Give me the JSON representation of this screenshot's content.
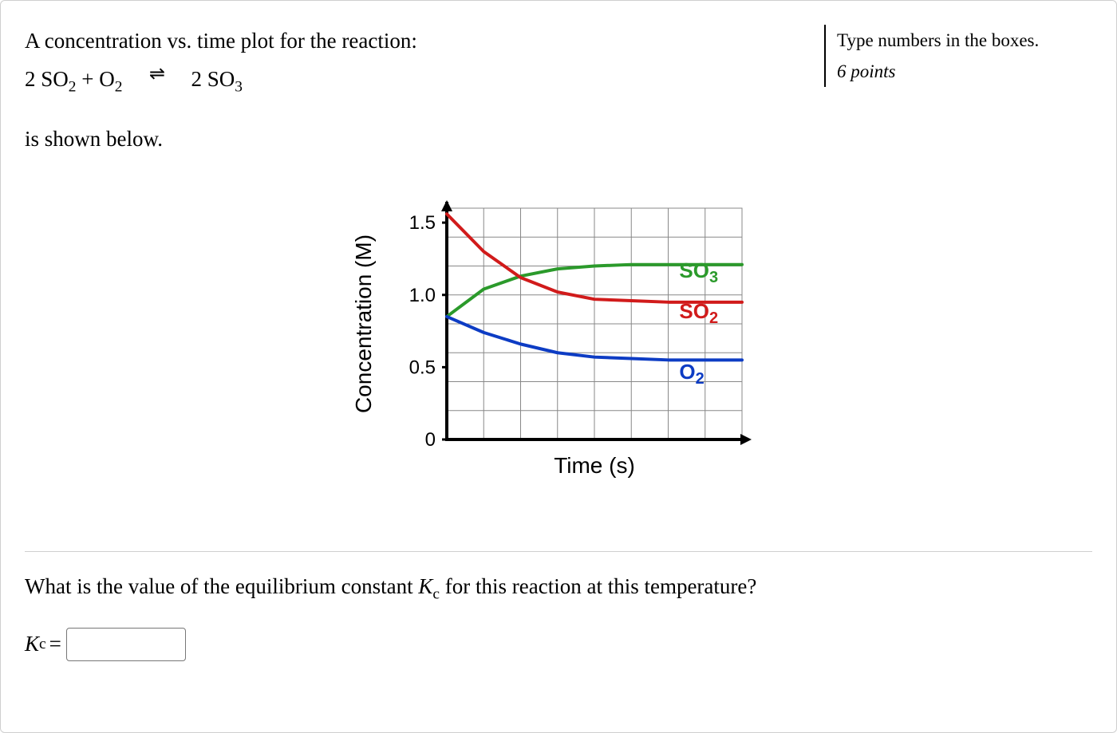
{
  "sidebar": {
    "instruction": "Type numbers in the boxes.",
    "points": "6 points"
  },
  "prompt": {
    "line1": "A concentration vs. time plot for the reaction:",
    "reaction_prefix": "2 SO",
    "so2_sub": "2",
    "plus": "  +  O",
    "o2_sub": "2",
    "product_prefix": "2 SO",
    "so3_sub": "3",
    "below": "is shown below."
  },
  "question": {
    "text_before_K": "What is the value of the equilibrium constant ",
    "k_letter": "K",
    "k_sub": "c",
    "text_after_K": " for this reaction at this temperature?"
  },
  "answer": {
    "k_letter": "K",
    "k_sub": "c",
    "equals": " = ",
    "value": ""
  },
  "chart_data": {
    "type": "line",
    "xlabel": "Time (s)",
    "ylabel": "Concentration (M)",
    "ylim": [
      0,
      1.6
    ],
    "yticks": [
      0,
      0.5,
      1.0,
      1.5
    ],
    "series": [
      {
        "name": "SO3",
        "label": "SO",
        "sub": "3",
        "color": "#2b9a2b",
        "points": [
          [
            0,
            0.85
          ],
          [
            1,
            1.04
          ],
          [
            2,
            1.13
          ],
          [
            3,
            1.18
          ],
          [
            4,
            1.2
          ],
          [
            5,
            1.21
          ],
          [
            6,
            1.21
          ],
          [
            7,
            1.21
          ],
          [
            8,
            1.21
          ]
        ]
      },
      {
        "name": "SO2",
        "label": "SO",
        "sub": "2",
        "color": "#d11b1b",
        "points": [
          [
            0,
            1.56
          ],
          [
            1,
            1.3
          ],
          [
            2,
            1.12
          ],
          [
            3,
            1.02
          ],
          [
            4,
            0.97
          ],
          [
            5,
            0.96
          ],
          [
            6,
            0.95
          ],
          [
            7,
            0.95
          ],
          [
            8,
            0.95
          ]
        ]
      },
      {
        "name": "O2",
        "label": "O",
        "sub": "2",
        "color": "#0d3cc4",
        "points": [
          [
            0,
            0.85
          ],
          [
            1,
            0.74
          ],
          [
            2,
            0.66
          ],
          [
            3,
            0.6
          ],
          [
            4,
            0.57
          ],
          [
            5,
            0.56
          ],
          [
            6,
            0.55
          ],
          [
            7,
            0.55
          ],
          [
            8,
            0.55
          ]
        ]
      }
    ],
    "legend_y": {
      "SO3": 1.12,
      "SO2": 0.84,
      "O2": 0.42
    }
  }
}
